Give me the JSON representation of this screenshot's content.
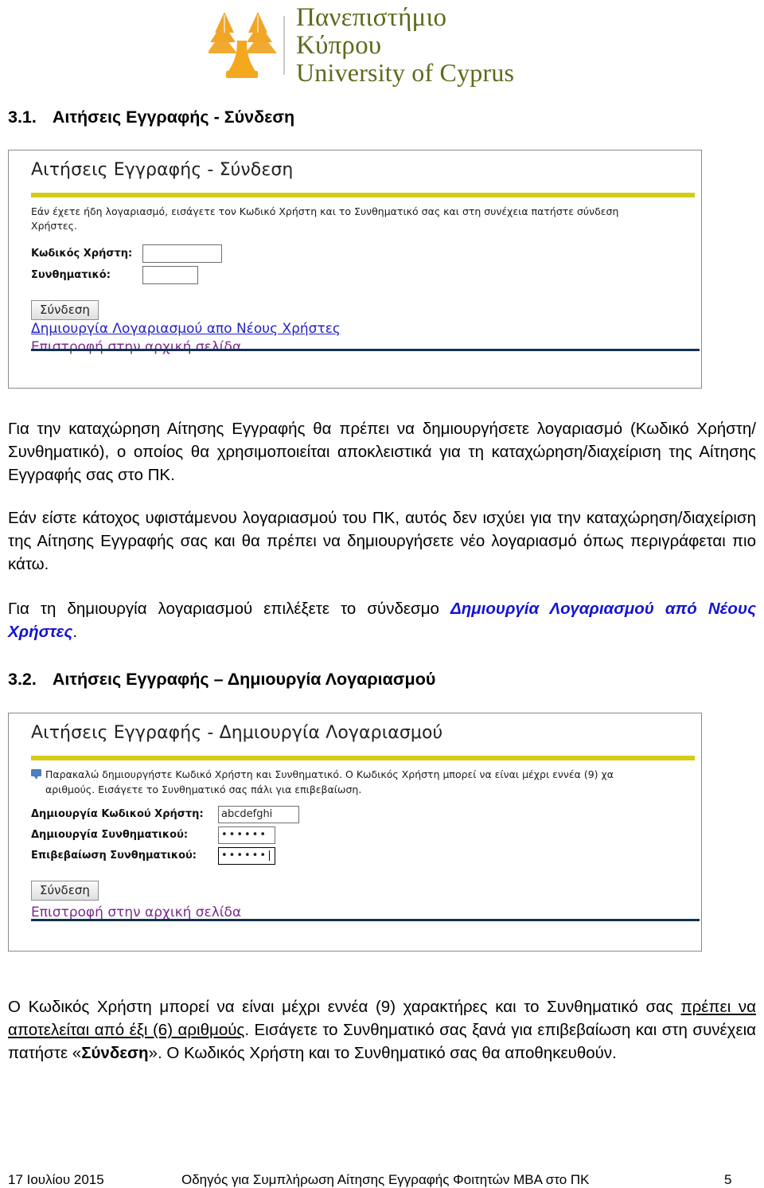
{
  "logo": {
    "greek_name": "Πανεπιστήμιο Κύπρου",
    "english_name": "University of Cyprus",
    "mark_color": "#f0a526",
    "text_color": "#5d6a1b"
  },
  "sections": [
    {
      "number": "3.1.",
      "title": "Αιτήσεις Εγγραφής - Σύνδεση"
    },
    {
      "number": "3.2.",
      "title": "Αιτήσεις Εγγραφής – Δημιουργία Λογαριασμού"
    }
  ],
  "screenshot_login": {
    "title": "Αιτήσεις Εγγραφής - Σύνδεση",
    "accent_bar_color": "#d4cc16",
    "note_line1": "Εάν έχετε ήδη λογαριασμό, εισάγετε τον Κωδικό Χρήστη και το Συνθηματικό σας και στη συνέχεια πατήστε σύνδεση",
    "note_line2": "Χρήστες.",
    "fields": [
      {
        "label": "Κωδικός Χρήστη:",
        "value": ""
      },
      {
        "label": "Συνθηματικό:",
        "value": ""
      }
    ],
    "submit_label": "Σύνδεση",
    "link_new_account": "Δημιουργία Λογαριασμού απο Νέους Χρήστες",
    "link_home": "Επιστροφή στην αρχική σελίδα",
    "rule_color": "#13314f"
  },
  "screenshot_create": {
    "title": "Αιτήσεις Εγγραφής - Δημιουργία Λογαριασμού",
    "accent_bar_color": "#d4cc16",
    "info_icon": "speech-bubble-icon",
    "note_line1": "Παρακαλώ δημιουργήστε Κωδικό Χρήστη και Συνθηματικό. Ο Κωδικός Χρήστη μπορεί να είναι μέχρι εννέα (9) χα",
    "note_line2": "αριθμούς. Εισάγετε το Συνθηματικό σας πάλι για επιβεβαίωση.",
    "fields": [
      {
        "label": "Δημιουργία Κωδικού Χρήστη:",
        "value": "abcdefghi"
      },
      {
        "label": "Δημιουργία Συνθηματικού:",
        "value": "••••••"
      },
      {
        "label": "Επιβεβαίωση Συνθηματικού:",
        "value": "••••••"
      }
    ],
    "submit_label": "Σύνδεση",
    "link_home": "Επιστροφή στην αρχική σελίδα",
    "rule_color": "#13314f"
  },
  "paragraphs": {
    "p1": "Για την καταχώρηση Αίτησης Εγγραφής θα πρέπει να δημιουργήσετε λογαριασμό (Κωδικό Χρήστη/Συνθηματικό), ο οποίος θα χρησιμοποιείται αποκλειστικά για τη καταχώρηση/διαχείριση της Αίτησης Εγγραφής σας στο ΠΚ.",
    "p2": "Εάν είστε κάτοχος υφιστάμενου λογαριασμού του ΠΚ, αυτός δεν ισχύει για την καταχώρηση/διαχείριση της Αίτησης Εγγραφής σας και θα πρέπει να δημιουργήσετε νέο λογαριασμό όπως περιγράφεται πιο κάτω.",
    "p3_before": "Για τη δημιουργία λογαριασμού επιλέξετε το σύνδεσμο ",
    "p3_link": "Δημιουργία Λογαριασμού από Νέους Χρήστες",
    "p3_after": ".",
    "p4_a": "Ο Κωδικός Χρήστη μπορεί να είναι μέχρι εννέα (9) χαρακτήρες και το Συνθηματικό σας ",
    "p4_underline": "πρέπει να αποτελείται από έξι (6) αριθμούς",
    "p4_b": ". Εισάγετε το Συνθηματικό σας ξανά για επιβεβαίωση και στη συνέχεια πατήστε «",
    "p4_bold": "Σύνδεση",
    "p4_c": "». Ο Κωδικός Χρήστη και το Συνθηματικό σας θα αποθηκευθούν."
  },
  "footer": {
    "date": "17 Ιουλίου 2015",
    "title": "Οδηγός  για Συμπλήρωση Αίτησης Εγγραφής Φοιτητών MBA στο ΠΚ",
    "page": "5"
  }
}
